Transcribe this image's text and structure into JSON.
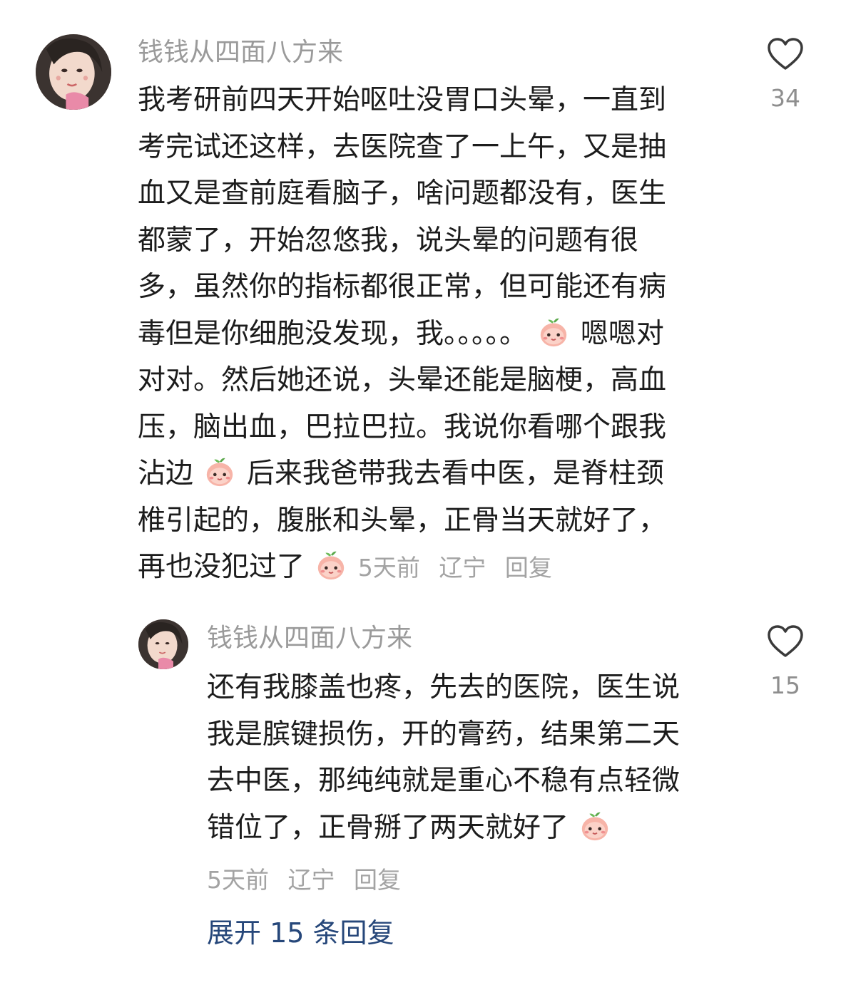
{
  "comment1": {
    "username": "钱钱从四面八方来",
    "lines": [
      "我考研前四天开始呕吐没胃口头晕，一直到",
      "考完试还这样，去医院查了一上午，又是抽",
      "血又是查前庭看脑子，啥问题都没有，医生",
      "都蒙了，开始忽悠我，说头晕的问题有很",
      "多，虽然你的指标都很正常，但可能还有病",
      "毒但是你细胞没发现，我。。。。。",
      "嗯嗯对",
      "对对。然后她还说，头晕还能是脑梗，高血",
      "压，脑出血，巴拉巴拉。我说你看哪个跟我",
      "沾边",
      "后来我爸带我去看中医，是脊柱颈",
      "椎引起的，腹胀和头晕，正骨当天就好了，",
      "再也没犯过了"
    ],
    "time": "5天前",
    "location": "辽宁",
    "reply": "回复",
    "likes": "34"
  },
  "comment2": {
    "username": "钱钱从四面八方来",
    "lines": [
      "还有我膝盖也疼，先去的医院，医生说",
      "我是膑键损伤，开的膏药，结果第二天",
      "去中医，那纯纯就是重心不稳有点轻微",
      "错位了，正骨掰了两天就好了"
    ],
    "time": "5天前",
    "location": "辽宁",
    "reply": "回复",
    "likes": "15"
  },
  "expand_replies": "展开 15 条回复",
  "icons": {
    "like": "heart-outline-icon",
    "emoji": "peach-face-emoji"
  }
}
